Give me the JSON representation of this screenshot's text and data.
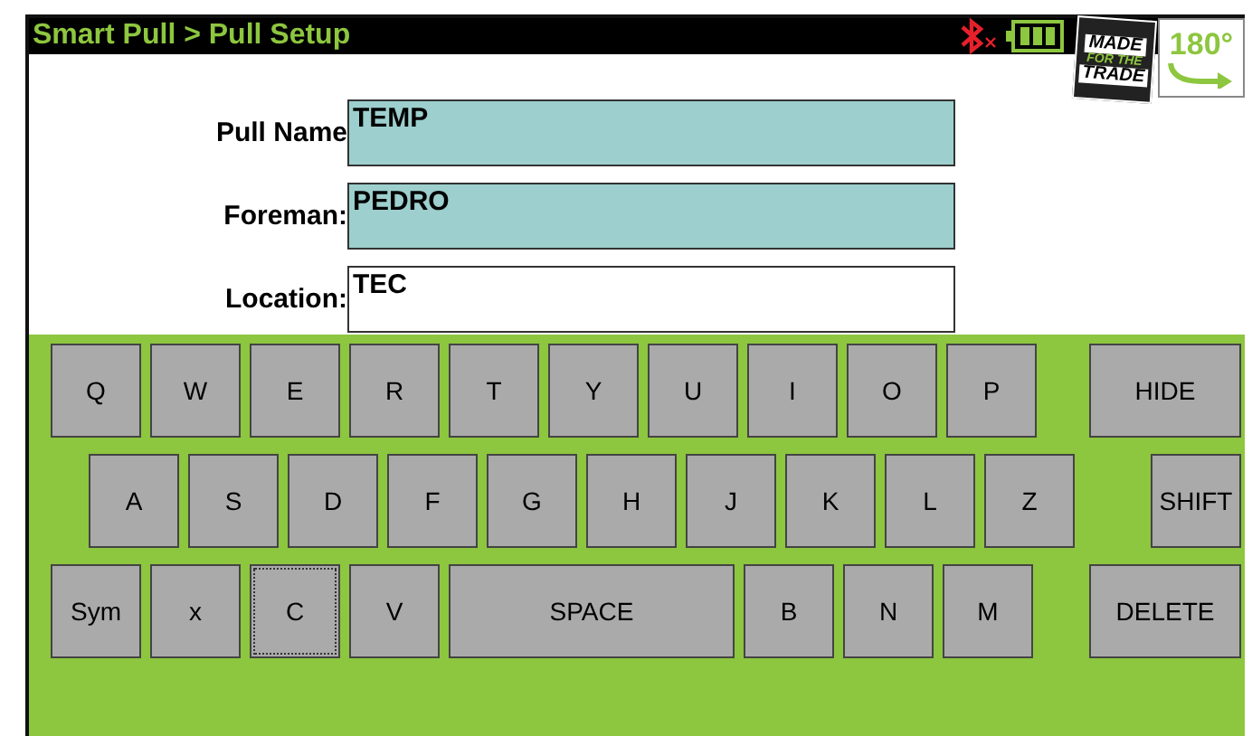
{
  "title_bar": {
    "title": "Smart Pull > Pull Setup",
    "bluetooth_connected": false,
    "logo": {
      "lines": [
        "MADE",
        "FOR THE",
        "TRADE"
      ]
    },
    "rotate_label": "180°"
  },
  "form": {
    "fields": [
      {
        "label": "Pull Name",
        "value": "TEMP",
        "shaded": true
      },
      {
        "label": "Foreman:",
        "value": "PEDRO",
        "shaded": true
      },
      {
        "label": "Location:",
        "value": "TEC",
        "shaded": false
      }
    ]
  },
  "keyboard": {
    "rows": [
      {
        "keys": [
          {
            "label": "Q",
            "kind": "char",
            "focused": false
          },
          {
            "label": "W",
            "kind": "char",
            "focused": false
          },
          {
            "label": "E",
            "kind": "char",
            "focused": false
          },
          {
            "label": "R",
            "kind": "char",
            "focused": false
          },
          {
            "label": "T",
            "kind": "char",
            "focused": false
          },
          {
            "label": "Y",
            "kind": "char",
            "focused": false
          },
          {
            "label": "U",
            "kind": "char",
            "focused": false
          },
          {
            "label": "I",
            "kind": "char",
            "focused": false
          },
          {
            "label": "O",
            "kind": "char",
            "focused": false
          },
          {
            "label": "P",
            "kind": "char",
            "focused": false
          },
          {
            "label": "HIDE",
            "kind": "action",
            "focused": false
          }
        ]
      },
      {
        "keys": [
          {
            "label": "A",
            "kind": "char",
            "focused": false
          },
          {
            "label": "S",
            "kind": "char",
            "focused": false
          },
          {
            "label": "D",
            "kind": "char",
            "focused": false
          },
          {
            "label": "F",
            "kind": "char",
            "focused": false
          },
          {
            "label": "G",
            "kind": "char",
            "focused": false
          },
          {
            "label": "H",
            "kind": "char",
            "focused": false
          },
          {
            "label": "J",
            "kind": "char",
            "focused": false
          },
          {
            "label": "K",
            "kind": "char",
            "focused": false
          },
          {
            "label": "L",
            "kind": "char",
            "focused": false
          },
          {
            "label": "Z",
            "kind": "char",
            "focused": false
          },
          {
            "label": "SHIFT",
            "kind": "shift",
            "focused": false
          }
        ]
      },
      {
        "keys": [
          {
            "label": "Sym",
            "kind": "char",
            "focused": false
          },
          {
            "label": "x",
            "kind": "char",
            "focused": false
          },
          {
            "label": "C",
            "kind": "char",
            "focused": true
          },
          {
            "label": "V",
            "kind": "char",
            "focused": false
          },
          {
            "label": "SPACE",
            "kind": "space",
            "focused": false
          },
          {
            "label": "B",
            "kind": "char",
            "focused": false
          },
          {
            "label": "N",
            "kind": "char",
            "focused": false
          },
          {
            "label": "M",
            "kind": "char",
            "focused": false
          },
          {
            "label": "DELETE",
            "kind": "action",
            "focused": false
          }
        ]
      }
    ]
  }
}
